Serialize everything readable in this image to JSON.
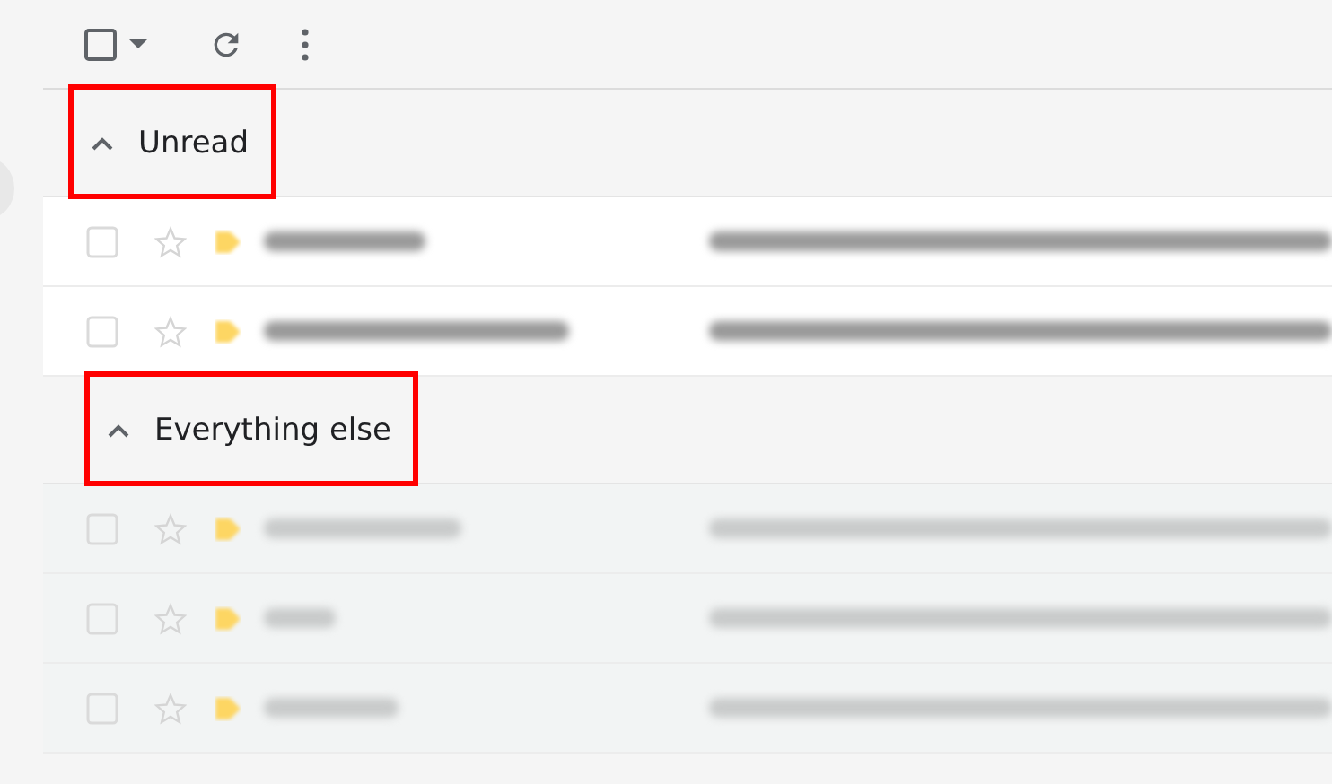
{
  "toolbar": {
    "select_all_checked": false
  },
  "sections": [
    {
      "title": "Unread",
      "expanded": true,
      "highlighted": true,
      "rows": [
        {
          "read": false,
          "checked": false
        },
        {
          "read": false,
          "checked": false
        }
      ]
    },
    {
      "title": "Everything else",
      "expanded": true,
      "highlighted": true,
      "rows": [
        {
          "read": true,
          "checked": false
        },
        {
          "read": true,
          "checked": false
        },
        {
          "read": true,
          "checked": false
        }
      ]
    }
  ]
}
